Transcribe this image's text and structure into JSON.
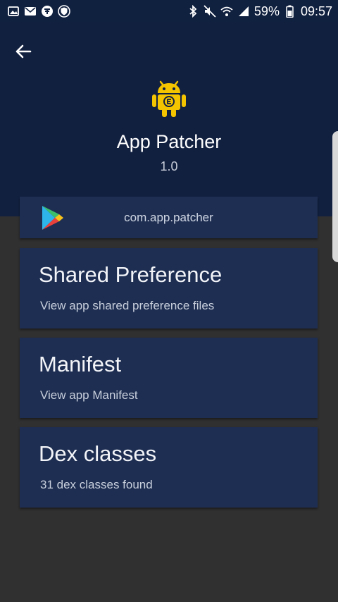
{
  "status_bar": {
    "battery": "59%",
    "time": "09:57",
    "left_icons": [
      "gallery-icon",
      "mail-icon",
      "torrent-icon",
      "shield-icon"
    ],
    "right_icons": [
      "bluetooth-icon",
      "mute-icon",
      "wifi-icon",
      "signal-icon",
      "battery-icon"
    ]
  },
  "header": {
    "app_name": "App Patcher",
    "version": "1.0",
    "icon": "android-icon",
    "accent": "#f5c400",
    "background": "#122040"
  },
  "package": {
    "name": "com.app.patcher",
    "icon": "play-store-icon"
  },
  "items": [
    {
      "title": "Shared Preference",
      "subtitle": "View app shared preference files"
    },
    {
      "title": "Manifest",
      "subtitle": "View app Manifest"
    },
    {
      "title": "Dex classes",
      "subtitle": "31 dex classes found"
    }
  ]
}
